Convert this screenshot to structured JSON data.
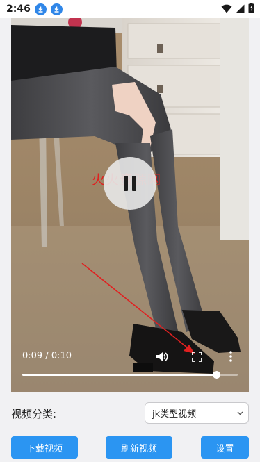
{
  "status_bar": {
    "time": "2:46",
    "icons": [
      "download-icon",
      "download-icon",
      "wifi-icon",
      "signal-icon",
      "battery-icon"
    ]
  },
  "video": {
    "watermark": "火火资源网",
    "timecode": "0:09 / 0:10",
    "progress": 0.9,
    "state": "playing",
    "icons": [
      "pause-icon",
      "volume-icon",
      "fullscreen-icon",
      "more-vert-icon"
    ]
  },
  "category": {
    "label": "视频分类:",
    "selected": "jk类型视频"
  },
  "buttons": {
    "download": "下载视频",
    "refresh": "刷新视频",
    "settings": "设置"
  },
  "colors": {
    "accent": "#2b95f2",
    "annotation": "#e02020"
  }
}
